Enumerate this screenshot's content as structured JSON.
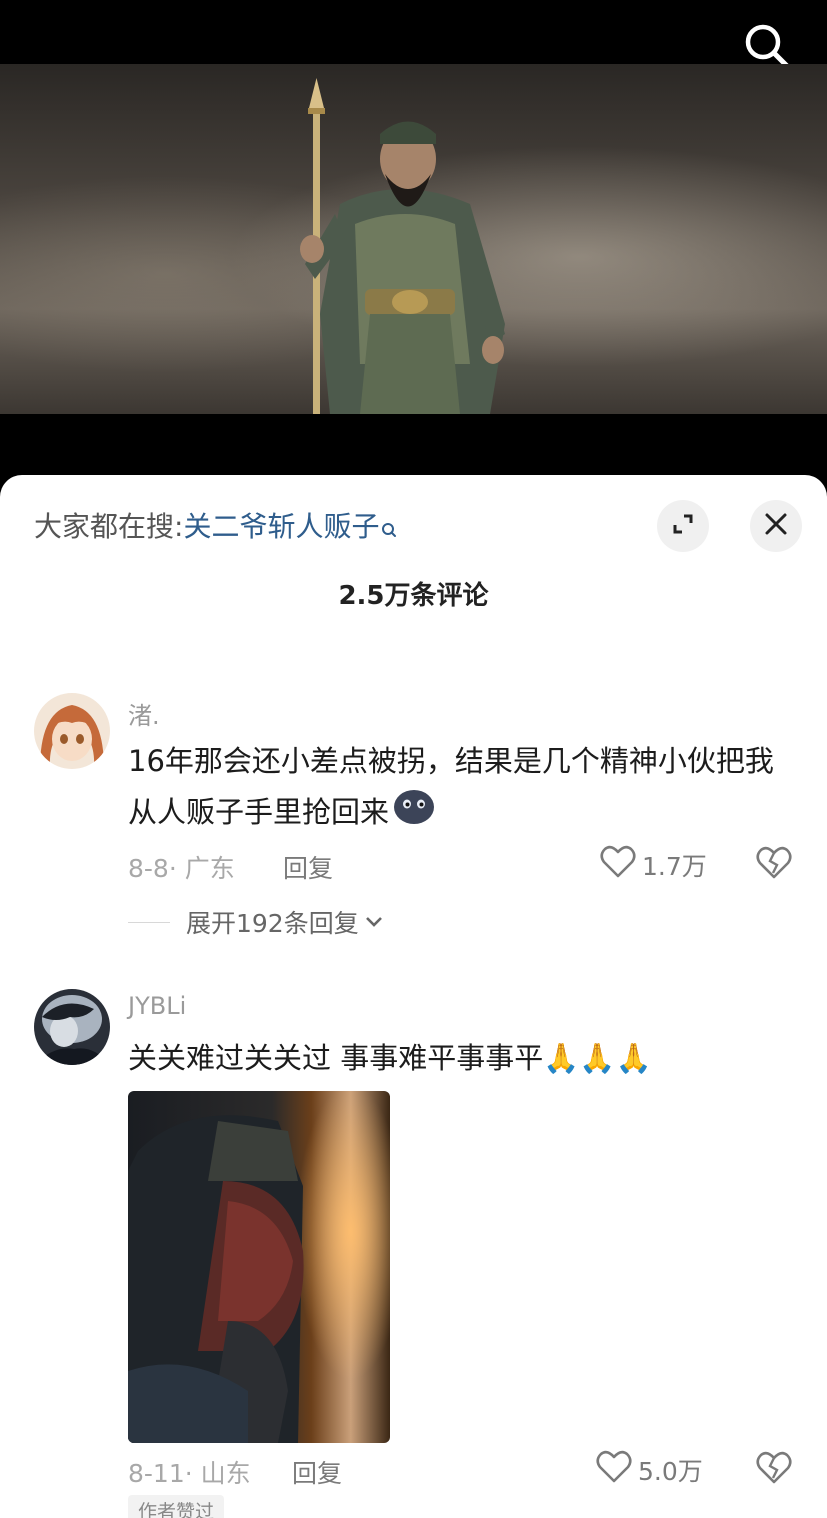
{
  "hot_search": {
    "label": "大家都在搜:",
    "query": "关二爷斩人贩子"
  },
  "comment_count": "2.5万条评论",
  "comments": [
    {
      "username": "渚.",
      "text": "16年那会还小差点被拐，结果是几个精神小伙把我从人贩子手里抢回来",
      "emoji": "blob-face-emoji",
      "meta": "8-8· 广东",
      "reply_label": "回复",
      "likes": "1.7万",
      "expand_replies": "展开192条回复"
    },
    {
      "username": "JYBLi",
      "text": "关关难过关关过 事事难平事事平",
      "emoji": "🙏🙏🙏",
      "meta": "8-11· 山东",
      "reply_label": "回复",
      "likes": "5.0万",
      "badge": "作者赞过"
    }
  ],
  "icons": [
    "search-icon",
    "expand-icon",
    "close-icon",
    "heart-icon",
    "broken-heart-icon",
    "chevron-down-icon"
  ],
  "colors": {
    "link": "#2f5d8c",
    "text": "#1c1c1c",
    "muted": "#a8a8a8"
  }
}
